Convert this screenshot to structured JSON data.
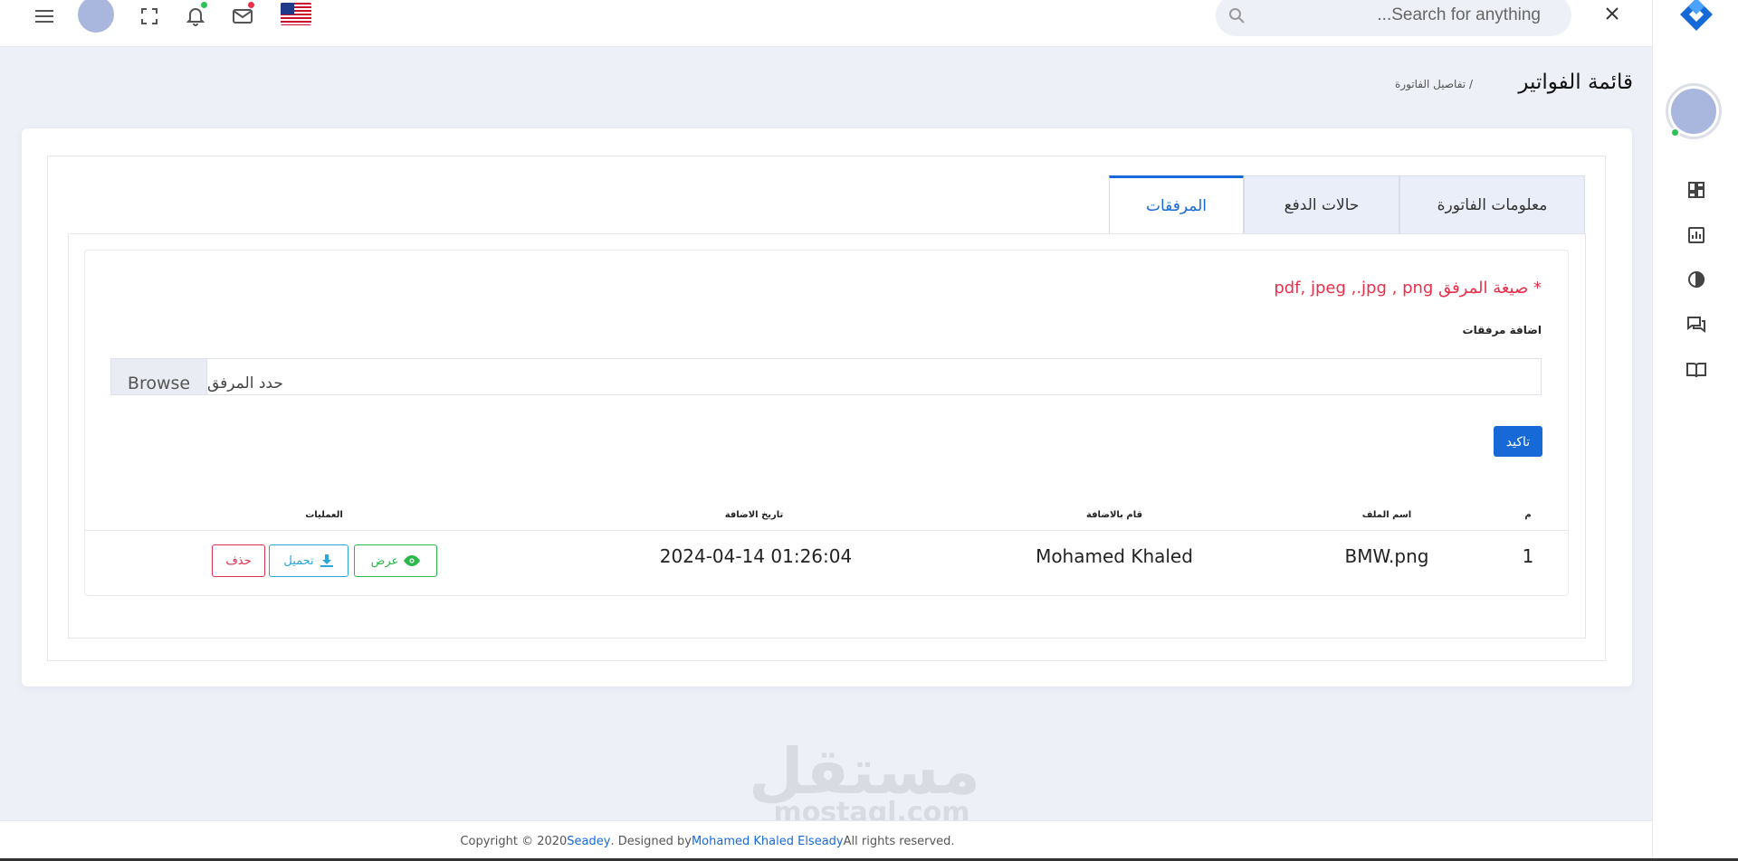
{
  "header": {
    "menu_icon": "menu-icon",
    "fullscreen_icon": "fullscreen-icon",
    "notification_icon": "bell-icon",
    "mail_icon": "mail-icon",
    "language_flag": "us-flag-icon",
    "search_placeholder": "Search for anything...",
    "close_icon": "close-icon",
    "colors": {
      "notification_dot": "#2bc155",
      "mail_dot": "#e8304a"
    }
  },
  "sidebar": {
    "logo": "brand-logo-icon",
    "items": [
      {
        "name": "dashboard",
        "icon": "dashboard-icon"
      },
      {
        "name": "reports",
        "icon": "chart-icon"
      },
      {
        "name": "analytics",
        "icon": "pie-icon"
      },
      {
        "name": "messages",
        "icon": "chat-icon"
      },
      {
        "name": "docs",
        "icon": "book-icon"
      }
    ]
  },
  "page": {
    "title": "قائمة الفواتير",
    "breadcrumb_sep": "/",
    "breadcrumb_current": "تفاصيل الفاتورة"
  },
  "tabs": [
    {
      "label": "معلومات الفاتورة",
      "active": false
    },
    {
      "label": "حالات الدفع",
      "active": false
    },
    {
      "label": "المرفقات",
      "active": true
    }
  ],
  "attachments": {
    "formats_note": "* صيغة المرفق pdf, jpeg ,.jpg , png",
    "add_label": "اضافة مرفقات",
    "browse_label": "Browse",
    "file_placeholder": "حدد المرفق",
    "confirm_label": "تاكيد",
    "table": {
      "headers": {
        "index": "م",
        "file_name": "اسم الملف",
        "added_by": "قام بالاضافة",
        "added_date": "تاريخ الاضافة",
        "actions": "العمليات"
      },
      "rows": [
        {
          "index": "1",
          "file_name": "BMW.png",
          "added_by": "Mohamed Khaled",
          "added_date": "2024-04-14 01:26:04",
          "view_label": "عرض",
          "download_label": "تحميل",
          "delete_label": "حذف"
        }
      ]
    }
  },
  "watermark": {
    "arabic": "مستقل",
    "english": "mostaql.com"
  },
  "footer": {
    "prefix": "Copyright © 2020 ",
    "brand": "Seadey",
    "middle": ". Designed by ",
    "designer": "Mohamed Khaled Elseady",
    "suffix": " All rights reserved."
  },
  "colors": {
    "accent": "#1769d8",
    "danger": "#e0304e",
    "success": "#2bb74a",
    "info": "#2aa6d9"
  }
}
